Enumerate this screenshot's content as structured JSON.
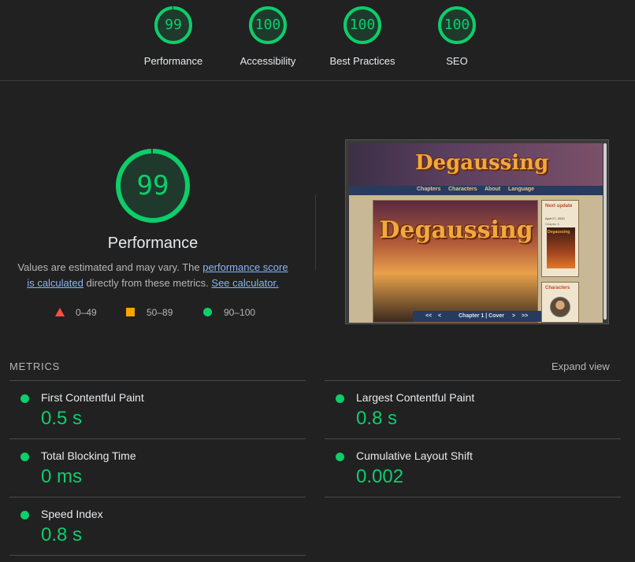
{
  "summary": {
    "gauges": [
      {
        "score": "99",
        "label": "Performance",
        "value": 99
      },
      {
        "score": "100",
        "label": "Accessibility",
        "value": 100
      },
      {
        "score": "100",
        "label": "Best Practices",
        "value": 100
      },
      {
        "score": "100",
        "label": "SEO",
        "value": 100
      }
    ]
  },
  "performance": {
    "score": "99",
    "value": 99,
    "title": "Performance",
    "desc_part1": "Values are estimated and may vary. The ",
    "desc_link1": "performance score is calculated",
    "desc_part2": " directly from these metrics. ",
    "desc_link2": "See calculator.",
    "legend": [
      {
        "range": "0–49",
        "shape": "triangle",
        "color": "#ff4e42"
      },
      {
        "range": "50–89",
        "shape": "square",
        "color": "#ffa400"
      },
      {
        "range": "90–100",
        "shape": "circle",
        "color": "#0cce6b"
      }
    ]
  },
  "thumbnail": {
    "site_logo": "Degaussing",
    "nav": [
      "Chapters",
      "Characters",
      "About",
      "Language"
    ],
    "cover_logo": "Degaussing",
    "pager": {
      "first": "<<",
      "prev": "<",
      "label": "Chapter 1 | Cover",
      "next": ">",
      "last": ">>"
    },
    "next_update": {
      "title": "Next update",
      "date": "April 27, 2020",
      "chapter": "Chapter 3",
      "mini_logo": "Degaussing"
    },
    "characters_title": "Characters"
  },
  "metrics": {
    "title": "METRICS",
    "expand_label": "Expand view",
    "items": [
      {
        "name": "First Contentful Paint",
        "value": "0.5 s"
      },
      {
        "name": "Largest Contentful Paint",
        "value": "0.8 s"
      },
      {
        "name": "Total Blocking Time",
        "value": "0 ms"
      },
      {
        "name": "Cumulative Layout Shift",
        "value": "0.002"
      },
      {
        "name": "Speed Index",
        "value": "0.8 s"
      }
    ]
  },
  "colors": {
    "pass": "#0cce6b",
    "average": "#ffa400",
    "fail": "#ff4e42",
    "background": "#212121",
    "link": "#8ab4f8"
  }
}
